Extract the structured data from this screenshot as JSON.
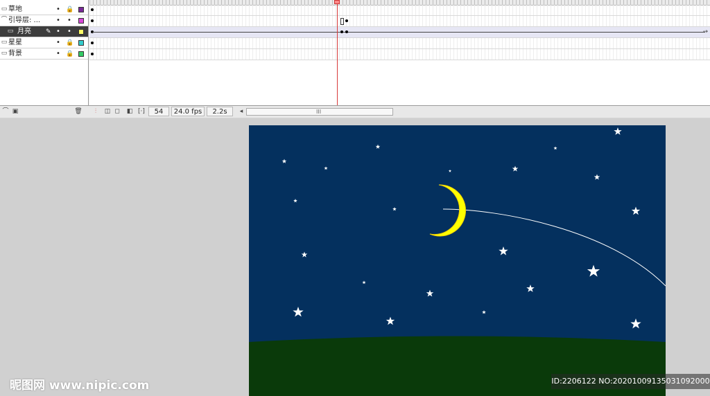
{
  "layers": [
    {
      "name": "草地",
      "icon": "layer-icon",
      "locked": true,
      "color": "#7a2a9a",
      "selected": false
    },
    {
      "name": "引导层: ...",
      "icon": "guide-layer-icon",
      "locked": false,
      "color": "#d848d8",
      "selected": false
    },
    {
      "name": "月亮",
      "icon": "guided-layer-icon",
      "locked": false,
      "color": "#ffff66",
      "selected": true
    },
    {
      "name": "星星",
      "icon": "layer-icon",
      "locked": true,
      "color": "#33cccc",
      "selected": false
    },
    {
      "name": "背景",
      "icon": "layer-icon",
      "locked": true,
      "color": "#33cc66",
      "selected": false
    }
  ],
  "timeline": {
    "current_frame": "54",
    "frame_rate": "24.0 fps",
    "elapsed_time": "2.2s",
    "scroll_grip": "III",
    "tween_arrow": "→"
  },
  "stage": {
    "sky_color": "#04305e",
    "ground_color": "#0a3a0a",
    "moon_color": "#ffff00",
    "motion_guide_color": "#ffffff"
  },
  "watermark": {
    "left": "昵图网 www.nipic.com",
    "right": "ID:2206122 NO:20201009135031092000"
  }
}
